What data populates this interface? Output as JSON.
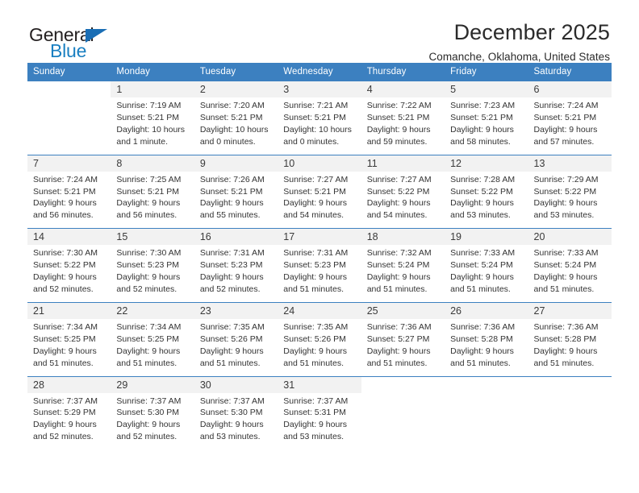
{
  "logo": {
    "word_one": "General",
    "word_two": "Blue",
    "triangle": "triangle-mark",
    "blue": "#1a7fc1"
  },
  "header": {
    "title": "December 2025",
    "subtitle": "Comanche, Oklahoma, United States"
  },
  "calendar": {
    "header_bg": "#3c80c0",
    "daynum_bg": "#f2f2f2",
    "weekdays": [
      "Sunday",
      "Monday",
      "Tuesday",
      "Wednesday",
      "Thursday",
      "Friday",
      "Saturday"
    ],
    "weeks": [
      [
        {
          "day": "",
          "sunrise": "",
          "sunset": "",
          "daylight_line1": "",
          "daylight_line2": ""
        },
        {
          "day": "1",
          "sunrise": "Sunrise: 7:19 AM",
          "sunset": "Sunset: 5:21 PM",
          "daylight_line1": "Daylight: 10 hours",
          "daylight_line2": "and 1 minute."
        },
        {
          "day": "2",
          "sunrise": "Sunrise: 7:20 AM",
          "sunset": "Sunset: 5:21 PM",
          "daylight_line1": "Daylight: 10 hours",
          "daylight_line2": "and 0 minutes."
        },
        {
          "day": "3",
          "sunrise": "Sunrise: 7:21 AM",
          "sunset": "Sunset: 5:21 PM",
          "daylight_line1": "Daylight: 10 hours",
          "daylight_line2": "and 0 minutes."
        },
        {
          "day": "4",
          "sunrise": "Sunrise: 7:22 AM",
          "sunset": "Sunset: 5:21 PM",
          "daylight_line1": "Daylight: 9 hours",
          "daylight_line2": "and 59 minutes."
        },
        {
          "day": "5",
          "sunrise": "Sunrise: 7:23 AM",
          "sunset": "Sunset: 5:21 PM",
          "daylight_line1": "Daylight: 9 hours",
          "daylight_line2": "and 58 minutes."
        },
        {
          "day": "6",
          "sunrise": "Sunrise: 7:24 AM",
          "sunset": "Sunset: 5:21 PM",
          "daylight_line1": "Daylight: 9 hours",
          "daylight_line2": "and 57 minutes."
        }
      ],
      [
        {
          "day": "7",
          "sunrise": "Sunrise: 7:24 AM",
          "sunset": "Sunset: 5:21 PM",
          "daylight_line1": "Daylight: 9 hours",
          "daylight_line2": "and 56 minutes."
        },
        {
          "day": "8",
          "sunrise": "Sunrise: 7:25 AM",
          "sunset": "Sunset: 5:21 PM",
          "daylight_line1": "Daylight: 9 hours",
          "daylight_line2": "and 56 minutes."
        },
        {
          "day": "9",
          "sunrise": "Sunrise: 7:26 AM",
          "sunset": "Sunset: 5:21 PM",
          "daylight_line1": "Daylight: 9 hours",
          "daylight_line2": "and 55 minutes."
        },
        {
          "day": "10",
          "sunrise": "Sunrise: 7:27 AM",
          "sunset": "Sunset: 5:21 PM",
          "daylight_line1": "Daylight: 9 hours",
          "daylight_line2": "and 54 minutes."
        },
        {
          "day": "11",
          "sunrise": "Sunrise: 7:27 AM",
          "sunset": "Sunset: 5:22 PM",
          "daylight_line1": "Daylight: 9 hours",
          "daylight_line2": "and 54 minutes."
        },
        {
          "day": "12",
          "sunrise": "Sunrise: 7:28 AM",
          "sunset": "Sunset: 5:22 PM",
          "daylight_line1": "Daylight: 9 hours",
          "daylight_line2": "and 53 minutes."
        },
        {
          "day": "13",
          "sunrise": "Sunrise: 7:29 AM",
          "sunset": "Sunset: 5:22 PM",
          "daylight_line1": "Daylight: 9 hours",
          "daylight_line2": "and 53 minutes."
        }
      ],
      [
        {
          "day": "14",
          "sunrise": "Sunrise: 7:30 AM",
          "sunset": "Sunset: 5:22 PM",
          "daylight_line1": "Daylight: 9 hours",
          "daylight_line2": "and 52 minutes."
        },
        {
          "day": "15",
          "sunrise": "Sunrise: 7:30 AM",
          "sunset": "Sunset: 5:23 PM",
          "daylight_line1": "Daylight: 9 hours",
          "daylight_line2": "and 52 minutes."
        },
        {
          "day": "16",
          "sunrise": "Sunrise: 7:31 AM",
          "sunset": "Sunset: 5:23 PM",
          "daylight_line1": "Daylight: 9 hours",
          "daylight_line2": "and 52 minutes."
        },
        {
          "day": "17",
          "sunrise": "Sunrise: 7:31 AM",
          "sunset": "Sunset: 5:23 PM",
          "daylight_line1": "Daylight: 9 hours",
          "daylight_line2": "and 51 minutes."
        },
        {
          "day": "18",
          "sunrise": "Sunrise: 7:32 AM",
          "sunset": "Sunset: 5:24 PM",
          "daylight_line1": "Daylight: 9 hours",
          "daylight_line2": "and 51 minutes."
        },
        {
          "day": "19",
          "sunrise": "Sunrise: 7:33 AM",
          "sunset": "Sunset: 5:24 PM",
          "daylight_line1": "Daylight: 9 hours",
          "daylight_line2": "and 51 minutes."
        },
        {
          "day": "20",
          "sunrise": "Sunrise: 7:33 AM",
          "sunset": "Sunset: 5:24 PM",
          "daylight_line1": "Daylight: 9 hours",
          "daylight_line2": "and 51 minutes."
        }
      ],
      [
        {
          "day": "21",
          "sunrise": "Sunrise: 7:34 AM",
          "sunset": "Sunset: 5:25 PM",
          "daylight_line1": "Daylight: 9 hours",
          "daylight_line2": "and 51 minutes."
        },
        {
          "day": "22",
          "sunrise": "Sunrise: 7:34 AM",
          "sunset": "Sunset: 5:25 PM",
          "daylight_line1": "Daylight: 9 hours",
          "daylight_line2": "and 51 minutes."
        },
        {
          "day": "23",
          "sunrise": "Sunrise: 7:35 AM",
          "sunset": "Sunset: 5:26 PM",
          "daylight_line1": "Daylight: 9 hours",
          "daylight_line2": "and 51 minutes."
        },
        {
          "day": "24",
          "sunrise": "Sunrise: 7:35 AM",
          "sunset": "Sunset: 5:26 PM",
          "daylight_line1": "Daylight: 9 hours",
          "daylight_line2": "and 51 minutes."
        },
        {
          "day": "25",
          "sunrise": "Sunrise: 7:36 AM",
          "sunset": "Sunset: 5:27 PM",
          "daylight_line1": "Daylight: 9 hours",
          "daylight_line2": "and 51 minutes."
        },
        {
          "day": "26",
          "sunrise": "Sunrise: 7:36 AM",
          "sunset": "Sunset: 5:28 PM",
          "daylight_line1": "Daylight: 9 hours",
          "daylight_line2": "and 51 minutes."
        },
        {
          "day": "27",
          "sunrise": "Sunrise: 7:36 AM",
          "sunset": "Sunset: 5:28 PM",
          "daylight_line1": "Daylight: 9 hours",
          "daylight_line2": "and 51 minutes."
        }
      ],
      [
        {
          "day": "28",
          "sunrise": "Sunrise: 7:37 AM",
          "sunset": "Sunset: 5:29 PM",
          "daylight_line1": "Daylight: 9 hours",
          "daylight_line2": "and 52 minutes."
        },
        {
          "day": "29",
          "sunrise": "Sunrise: 7:37 AM",
          "sunset": "Sunset: 5:30 PM",
          "daylight_line1": "Daylight: 9 hours",
          "daylight_line2": "and 52 minutes."
        },
        {
          "day": "30",
          "sunrise": "Sunrise: 7:37 AM",
          "sunset": "Sunset: 5:30 PM",
          "daylight_line1": "Daylight: 9 hours",
          "daylight_line2": "and 53 minutes."
        },
        {
          "day": "31",
          "sunrise": "Sunrise: 7:37 AM",
          "sunset": "Sunset: 5:31 PM",
          "daylight_line1": "Daylight: 9 hours",
          "daylight_line2": "and 53 minutes."
        },
        {
          "day": "",
          "sunrise": "",
          "sunset": "",
          "daylight_line1": "",
          "daylight_line2": ""
        },
        {
          "day": "",
          "sunrise": "",
          "sunset": "",
          "daylight_line1": "",
          "daylight_line2": ""
        },
        {
          "day": "",
          "sunrise": "",
          "sunset": "",
          "daylight_line1": "",
          "daylight_line2": ""
        }
      ]
    ]
  }
}
